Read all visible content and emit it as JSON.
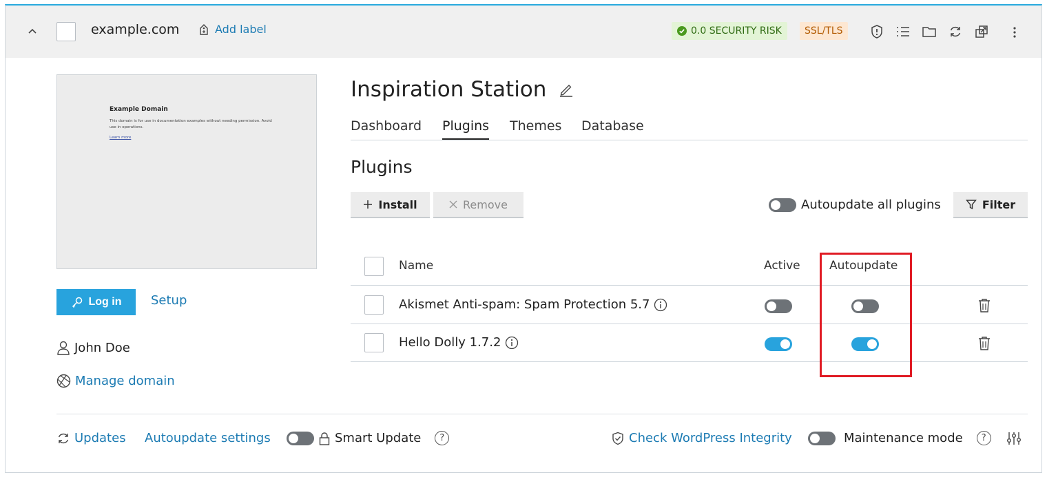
{
  "header": {
    "domain": "example.com",
    "add_label": "Add label",
    "security_badge": "0.0 SECURITY RISK",
    "ssl_badge": "SSL/TLS",
    "icons": [
      "shield-icon",
      "list-icon",
      "folder-icon",
      "refresh-icon",
      "external-link-icon",
      "kebab-menu-icon"
    ]
  },
  "preview": {
    "title": "Example Domain",
    "text": "This domain is for use in documentation examples without needing permission. Avoid use in operations.",
    "link": "Learn more"
  },
  "sidebar": {
    "login_label": "Log in",
    "setup_label": "Setup",
    "user_name": "John Doe",
    "manage_domain": "Manage domain"
  },
  "main": {
    "site_title": "Inspiration Station",
    "tabs": [
      {
        "label": "Dashboard"
      },
      {
        "label": "Plugins"
      },
      {
        "label": "Themes"
      },
      {
        "label": "Database"
      }
    ],
    "active_tab": "Plugins",
    "section_title": "Plugins",
    "install_label": "Install",
    "remove_label": "Remove",
    "autoupdate_all_label": "Autoupdate all plugins",
    "autoupdate_all_on": false,
    "filter_label": "Filter"
  },
  "table": {
    "columns": {
      "name": "Name",
      "active": "Active",
      "autoupdate": "Autoupdate"
    },
    "rows": [
      {
        "name": "Akismet Anti-spam: Spam Protection 5.7",
        "active": false,
        "autoupdate": false
      },
      {
        "name": "Hello Dolly 1.7.2",
        "active": true,
        "autoupdate": true
      }
    ]
  },
  "footer": {
    "updates": "Updates",
    "autoupdate_settings": "Autoupdate settings",
    "smart_update": "Smart Update",
    "smart_update_on": false,
    "check_integrity": "Check WordPress Integrity",
    "maintenance_mode": "Maintenance mode",
    "maintenance_on": false
  },
  "colors": {
    "accent": "#28a3dd",
    "link": "#1c7bb3",
    "highlight": "#e01b24"
  }
}
